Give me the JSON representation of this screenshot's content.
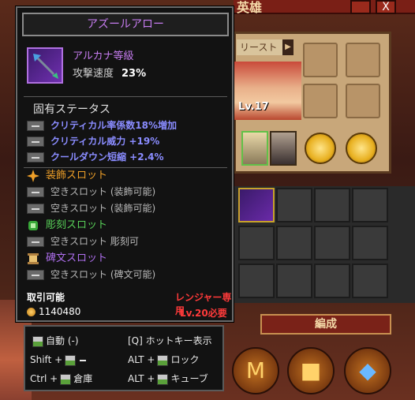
{
  "background": {
    "hero_title": "英雄",
    "tab_label": "リースト",
    "tab_arrow": "▶",
    "level": "Lv.17",
    "compose_button": "編成",
    "close_glyph": "X"
  },
  "tooltip": {
    "title": "アズールアロー",
    "item_icon": "azure-arrow-icon",
    "grade": "アルカナ等級",
    "stat_label": "攻撃速度",
    "stat_value": "23%",
    "section_inherent": "固有ステータス",
    "inherent_stats": [
      "クリティカル率係数18%増加",
      "クリティカル威力 +19%",
      "クールダウン短縮 +2.4%"
    ],
    "slots": [
      {
        "head": "装飾スロット",
        "color": "#f0a028",
        "entries": [
          "空きスロット (装飾可能)",
          "空きスロット (装飾可能)"
        ]
      },
      {
        "head": "彫刻スロット",
        "color": "#58d058",
        "entries": [
          "空きスロット 彫刻可"
        ]
      },
      {
        "head": "碑文スロット",
        "color": "#b070f0",
        "entries": [
          "空きスロット (碑文可能)"
        ]
      }
    ],
    "tradable": "取引可能",
    "class_restriction": "レンジャー専用",
    "price": "1140480",
    "level_requirement": "Lv.20必要"
  },
  "hotkeys": {
    "auto": "自動 (-)",
    "hotkey_display": "[Q] ホットキー表示",
    "shift_prefix": "Shift +",
    "alt_prefix_1": "ALT +",
    "lock": "ロック",
    "ctrl_prefix": "Ctrl +",
    "warehouse": "倉庫",
    "alt_prefix_2": "ALT +",
    "cube": "キューブ"
  }
}
